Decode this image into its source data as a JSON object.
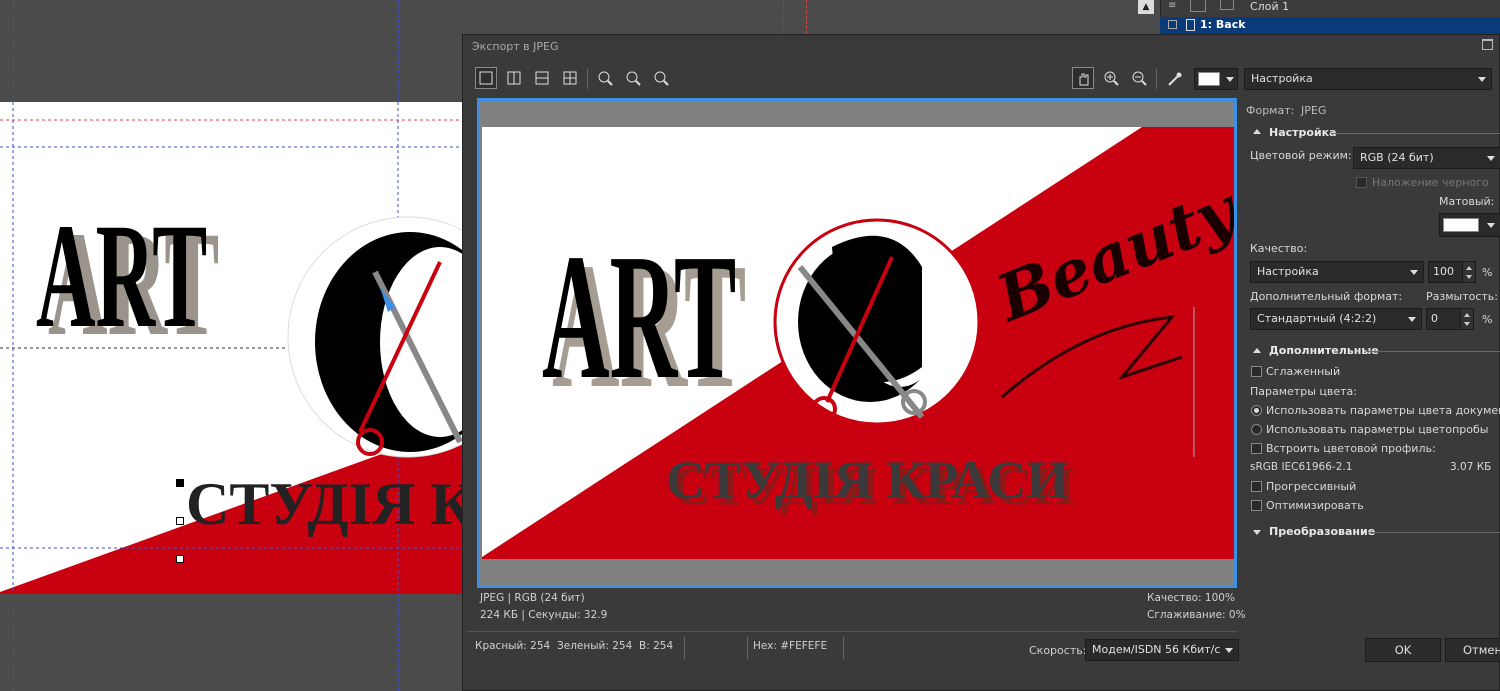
{
  "docker": {
    "layer1": "Слой 1",
    "layer_back": "1: Back"
  },
  "dialog": {
    "title": "Экспорт в JPEG",
    "preset": "Настройка"
  },
  "preview": {
    "text_art": "ART",
    "text_beauty": "Beauty",
    "text_studio": "СТУДІЯ КРАСИ",
    "info_format": "JPEG  |  RGB (24 бит)",
    "info_size": "224 КБ  |  Секунды: 32.9",
    "info_quality": "Качество: 100%",
    "info_smoothing": "Сглаживание: 0%"
  },
  "status": {
    "red": "Красный: 254",
    "green": "Зеленый: 254",
    "blue": "B: 254",
    "hex": "Hex: #FEFEFE",
    "speed_label": "Скорость:",
    "speed_value": "Модем/ISDN 56 Кбит/с"
  },
  "panel": {
    "format_label": "Формат:",
    "format_value": "JPEG",
    "settings_section": "Настройка",
    "color_mode_label": "Цветовой режим:",
    "color_mode_value": "RGB (24 бит)",
    "overprint_black": "Наложение черного",
    "matte_label": "Матовый:",
    "quality_label": "Качество:",
    "quality_preset": "Настройка",
    "quality_value": "100",
    "percent": "%",
    "extra_format_label": "Дополнительный формат:",
    "blur_label": "Размытость:",
    "extra_format_value": "Стандартный (4:2:2)",
    "blur_value": "0",
    "additional_section": "Дополнительные",
    "smoothed": "Сглаженный",
    "color_params_label": "Параметры цвета:",
    "use_doc_colors": "Использовать параметры цвета документа",
    "use_proof_colors": "Использовать параметры цветопробы",
    "embed_profile": "Встроить цветовой профиль:",
    "profile_name": "sRGB IEC61966-2.1",
    "profile_size": "3.07 КБ",
    "progressive": "Прогрессивный",
    "optimize": "Оптимизировать",
    "transform_section": "Преобразование",
    "ok": "OK",
    "cancel": "Отмена"
  },
  "colors": {
    "accent": "#3d8fe6",
    "logo_red": "#c8000f",
    "dialog_bg": "#3a3a3a",
    "selection": "#0a3a78"
  }
}
